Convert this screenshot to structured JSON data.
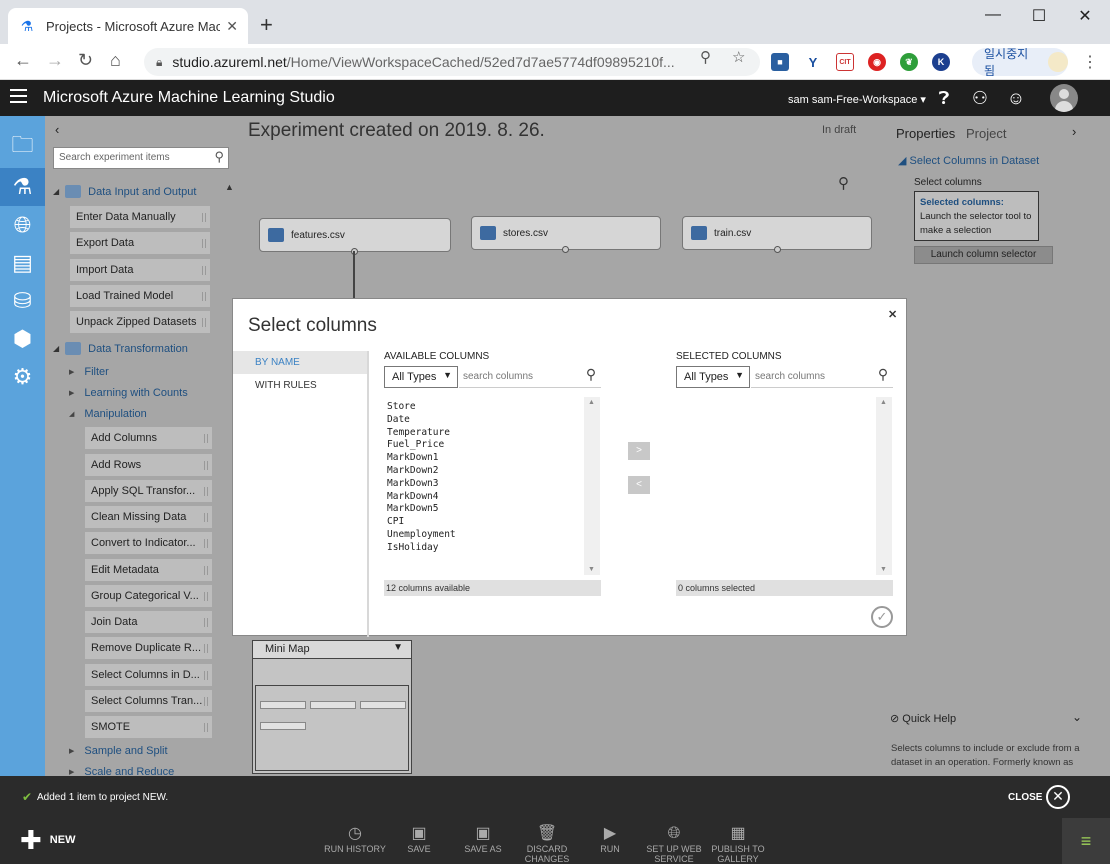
{
  "browser": {
    "tab_title": "Projects - Microsoft Azure Machi",
    "url_host": "studio.azureml.net",
    "url_path": "/Home/ViewWorkspaceCached/52ed7d7ae5774df09895210f...",
    "profile_label": "일시중지됨"
  },
  "header": {
    "app_title": "Microsoft Azure Machine Learning Studio",
    "workspace": "sam sam-Free-Workspace ▾"
  },
  "palette": {
    "search_placeholder": "Search experiment items",
    "group1": "Data Input and Output",
    "group1_items": [
      "Enter Data Manually",
      "Export Data",
      "Import Data",
      "Load Trained Model",
      "Unpack Zipped Datasets"
    ],
    "group2": "Data Transformation",
    "sub_filter": "Filter",
    "sub_learning": "Learning with Counts",
    "sub_manipulation": "Manipulation",
    "manip_items": [
      "Add Columns",
      "Add Rows",
      "Apply SQL Transfor...",
      "Clean Missing Data",
      "Convert to Indicator...",
      "Edit Metadata",
      "Group Categorical V...",
      "Join Data",
      "Remove Duplicate R...",
      "Select Columns in D...",
      "Select Columns Tran...",
      "SMOTE"
    ],
    "sub_sample": "Sample and Split",
    "sub_scale": "Scale and Reduce"
  },
  "canvas": {
    "title": "Experiment created on 2019. 8. 26.",
    "status": "In draft",
    "modules": [
      "features.csv",
      "stores.csv",
      "train.csv"
    ],
    "minimap_label": "Mini Map"
  },
  "properties": {
    "tab_properties": "Properties",
    "tab_project": "Project",
    "section": "Select Columns in Dataset",
    "label": "Select columns",
    "box_title": "Selected columns:",
    "box_text": "Launch the selector tool to make a selection",
    "launch_button": "Launch column selector",
    "quick_help": "Quick Help",
    "help_text": "Selects columns to include or exclude from a dataset in an operation. Formerly known as"
  },
  "modal": {
    "title": "Select columns",
    "mode_by_name": "BY NAME",
    "mode_with_rules": "WITH RULES",
    "available_header": "AVAILABLE COLUMNS",
    "selected_header": "SELECTED COLUMNS",
    "type_filter": "All Types",
    "search_placeholder": "search columns",
    "available_columns": [
      "Store",
      "Date",
      "Temperature",
      "Fuel_Price",
      "MarkDown1",
      "MarkDown2",
      "MarkDown3",
      "MarkDown4",
      "MarkDown5",
      "CPI",
      "Unemployment",
      "IsHoliday"
    ],
    "available_count": "12 columns available",
    "selected_count": "0 columns selected",
    "add_label": ">",
    "remove_label": "<"
  },
  "notification": {
    "text": "Added 1 item to project NEW.",
    "close_label": "CLOSE"
  },
  "toolbar": {
    "new_label": "NEW",
    "buttons": [
      {
        "label": "RUN HISTORY",
        "icon": "clock-icon"
      },
      {
        "label": "SAVE",
        "icon": "save-icon"
      },
      {
        "label": "SAVE AS",
        "icon": "save-as-icon"
      },
      {
        "label": "DISCARD CHANGES",
        "icon": "trash-icon"
      },
      {
        "label": "RUN",
        "icon": "play-icon"
      },
      {
        "label": "SET UP WEB SERVICE",
        "icon": "globe-icon"
      },
      {
        "label": "PUBLISH TO GALLERY",
        "icon": "gallery-icon"
      }
    ]
  },
  "colors": {
    "accent": "#3b82c4",
    "nav_bg": "#5ba3dc",
    "header_bg": "#1e1e1e",
    "overlay_gray": "#a6a6a6",
    "success": "#7fbf3f"
  }
}
